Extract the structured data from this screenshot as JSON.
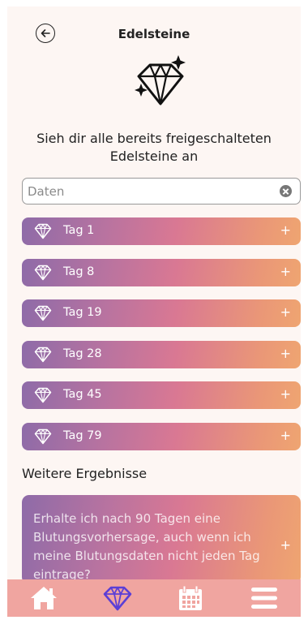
{
  "header": {
    "title": "Edelsteine"
  },
  "intro": {
    "subtitle": "Sieh dir alle bereits freigeschalteten Edelsteine an"
  },
  "search": {
    "placeholder": "Daten",
    "value": ""
  },
  "tags": [
    {
      "label": "Tag 1"
    },
    {
      "label": "Tag 8"
    },
    {
      "label": "Tag 19"
    },
    {
      "label": "Tag 28"
    },
    {
      "label": "Tag 45"
    },
    {
      "label": "Tag 79"
    }
  ],
  "more": {
    "title": "Weitere Ergebnisse",
    "items": [
      {
        "text": "Erhalte ich nach 90 Tagen eine Blutungsvorhersage, auch wenn ich meine Blutungsdaten nicht jeden Tag eintrage?"
      }
    ]
  },
  "expand_symbol": "+",
  "nav": {
    "items": [
      {
        "icon": "home-icon",
        "active": false
      },
      {
        "icon": "diamond-icon",
        "active": true
      },
      {
        "icon": "calendar-icon",
        "active": false
      },
      {
        "icon": "menu-icon",
        "active": false
      }
    ]
  },
  "colors": {
    "gradient_start": "#8e6ba8",
    "gradient_end": "#efa571",
    "nav_background": "#f0a5a0",
    "nav_active": "#5b3fd6",
    "nav_inactive": "#ffffff"
  }
}
